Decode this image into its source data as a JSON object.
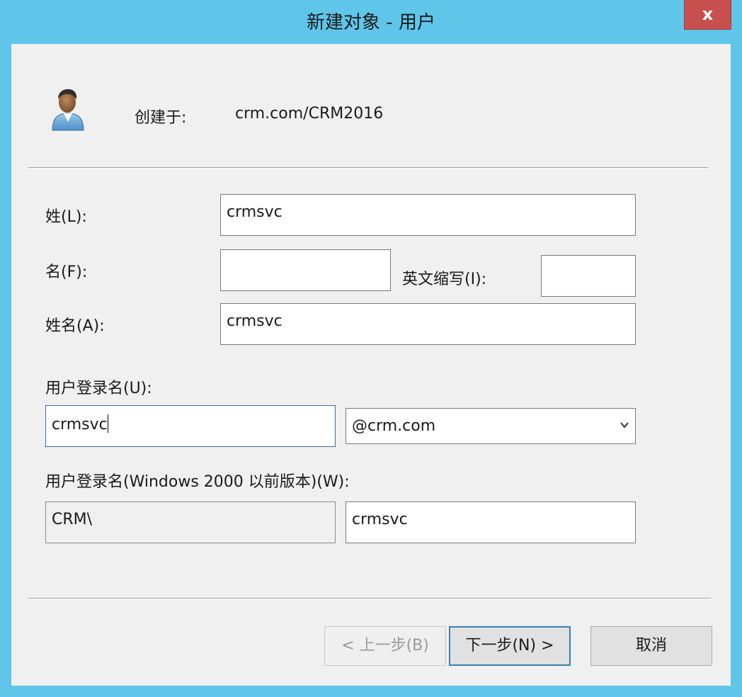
{
  "window": {
    "title": "新建对象 - 用户",
    "close_glyph": "x"
  },
  "header": {
    "icon": "user-icon",
    "created_in_label": "创建于:",
    "created_in_value": "crm.com/CRM2016"
  },
  "form": {
    "last_name_label": "姓(L):",
    "last_name_value": "crmsvc",
    "first_name_label": "名(F):",
    "first_name_value": "",
    "initials_label": "英文缩写(I):",
    "initials_value": "",
    "full_name_label": "姓名(A):",
    "full_name_value": "crmsvc",
    "logon_name_label": "用户登录名(U):",
    "logon_name_value": "crmsvc",
    "upn_suffix_selected": "@crm.com",
    "legacy_logon_label": "用户登录名(Windows 2000 以前版本)(W):",
    "legacy_domain_value": "CRM\\",
    "legacy_logon_value": "crmsvc"
  },
  "buttons": {
    "back_label": "< 上一步(B)",
    "next_label": "下一步(N) >",
    "cancel_label": "取消"
  },
  "colors": {
    "titlebar": "#5fc6ea",
    "close_button": "#c7504f",
    "dialog_background": "#f0f0f0"
  }
}
